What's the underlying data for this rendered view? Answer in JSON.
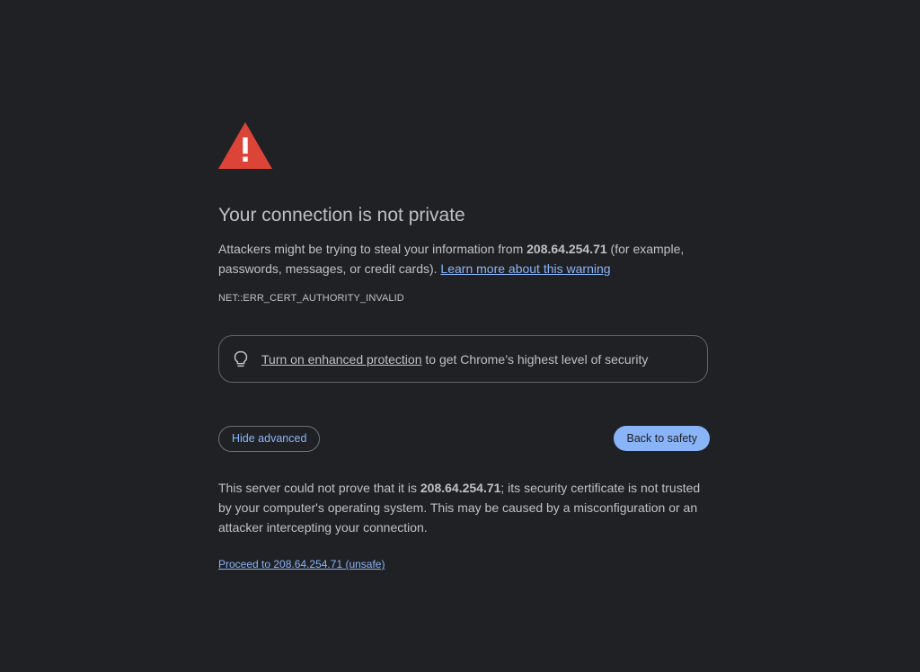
{
  "colors": {
    "background": "#202124",
    "text": "#bdc1c6",
    "link": "#8ab4f8",
    "warning_icon": "#db4437",
    "primary_button": "#8ab4f8"
  },
  "icons": {
    "warning": "warning-triangle-icon",
    "lightbulb": "lightbulb-icon"
  },
  "interstitial": {
    "title": "Your connection is not private",
    "description": {
      "prefix": "Attackers might be trying to steal your information from ",
      "host": "208.64.254.71",
      "suffix": " (for example, passwords, messages, or credit cards). ",
      "learn_more_link": "Learn more about this warning"
    },
    "error_code": "NET::ERR_CERT_AUTHORITY_INVALID",
    "protection_box": {
      "link_text": "Turn on enhanced protection",
      "text": " to get Chrome’s highest level of security"
    },
    "buttons": {
      "hide_advanced": "Hide advanced",
      "back_to_safety": "Back to safety"
    },
    "details": {
      "prefix": "This server could not prove that it is ",
      "host": "208.64.254.71",
      "suffix": "; its security certificate is not trusted by your computer's operating system. This may be caused by a misconfiguration or an attacker intercepting your connection."
    },
    "proceed_link": "Proceed to 208.64.254.71 (unsafe)"
  }
}
